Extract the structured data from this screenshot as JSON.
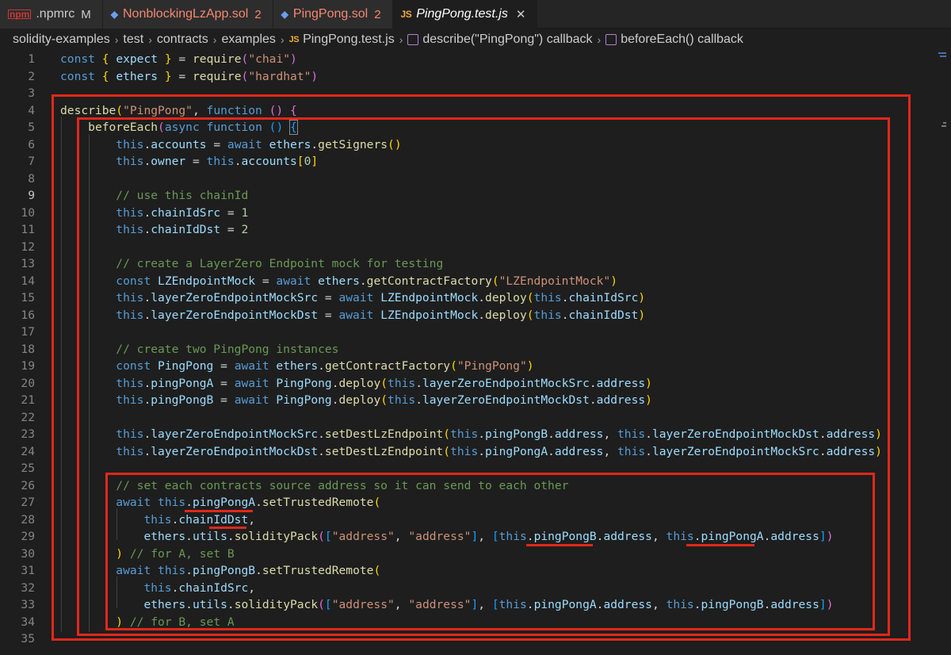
{
  "tabs": [
    {
      "icon": "npm-icon",
      "icon_text": "npm",
      "label": ".npmrc",
      "badge": "M",
      "active": false,
      "error": false
    },
    {
      "icon": "ethereum-icon",
      "icon_text": "◆",
      "label": "NonblockingLzApp.sol",
      "badge": "2",
      "active": false,
      "error": true
    },
    {
      "icon": "ethereum-icon",
      "icon_text": "◆",
      "label": "PingPong.sol",
      "badge": "2",
      "active": false,
      "error": true
    },
    {
      "icon": "js-icon",
      "icon_text": "JS",
      "label": "PingPong.test.js",
      "badge": "",
      "active": true,
      "error": false
    }
  ],
  "close_glyph": "✕",
  "breadcrumb": {
    "items": [
      "solidity-examples",
      "test",
      "contracts",
      "examples"
    ],
    "file_icon_text": "JS",
    "file": "PingPong.test.js",
    "symbols": [
      "describe(\"PingPong\") callback",
      "beforeEach() callback"
    ],
    "separator": "›"
  },
  "current_line": 9,
  "code_lines": [
    [
      [
        "kw",
        "const"
      ],
      [
        "p",
        " "
      ],
      [
        "b1",
        "{"
      ],
      [
        "p",
        " "
      ],
      [
        "var",
        "expect"
      ],
      [
        "p",
        " "
      ],
      [
        "b1",
        "}"
      ],
      [
        "p",
        " = "
      ],
      [
        "fn",
        "require"
      ],
      [
        "b2",
        "("
      ],
      [
        "str",
        "\"chai\""
      ],
      [
        "b2",
        ")"
      ]
    ],
    [
      [
        "kw",
        "const"
      ],
      [
        "p",
        " "
      ],
      [
        "b1",
        "{"
      ],
      [
        "p",
        " "
      ],
      [
        "var",
        "ethers"
      ],
      [
        "p",
        " "
      ],
      [
        "b1",
        "}"
      ],
      [
        "p",
        " = "
      ],
      [
        "fn",
        "require"
      ],
      [
        "b2",
        "("
      ],
      [
        "str",
        "\"hardhat\""
      ],
      [
        "b2",
        ")"
      ]
    ],
    [],
    [
      [
        "fn",
        "describe"
      ],
      [
        "b1",
        "("
      ],
      [
        "str",
        "\"PingPong\""
      ],
      [
        "p",
        ", "
      ],
      [
        "kw",
        "function"
      ],
      [
        "p",
        " "
      ],
      [
        "b2",
        "()"
      ],
      [
        "p",
        " "
      ],
      [
        "b2",
        "{"
      ]
    ],
    [
      [
        "p",
        "    "
      ],
      [
        "fn",
        "beforeEach"
      ],
      [
        "b2",
        "("
      ],
      [
        "kw",
        "async"
      ],
      [
        "p",
        " "
      ],
      [
        "kw",
        "function"
      ],
      [
        "p",
        " "
      ],
      [
        "b3",
        "()"
      ],
      [
        "p",
        " "
      ],
      [
        "b3c",
        "{"
      ]
    ],
    [
      [
        "p",
        "        "
      ],
      [
        "kw",
        "this"
      ],
      [
        "p",
        "."
      ],
      [
        "var",
        "accounts"
      ],
      [
        "p",
        " = "
      ],
      [
        "kw",
        "await"
      ],
      [
        "p",
        " "
      ],
      [
        "var",
        "ethers"
      ],
      [
        "p",
        "."
      ],
      [
        "fn",
        "getSigners"
      ],
      [
        "b1",
        "()"
      ]
    ],
    [
      [
        "p",
        "        "
      ],
      [
        "kw",
        "this"
      ],
      [
        "p",
        "."
      ],
      [
        "var",
        "owner"
      ],
      [
        "p",
        " = "
      ],
      [
        "kw",
        "this"
      ],
      [
        "p",
        "."
      ],
      [
        "var",
        "accounts"
      ],
      [
        "b1",
        "["
      ],
      [
        "num",
        "0"
      ],
      [
        "b1",
        "]"
      ]
    ],
    [],
    [
      [
        "p",
        "        "
      ],
      [
        "cmt",
        "// use this chainId"
      ]
    ],
    [
      [
        "p",
        "        "
      ],
      [
        "kw",
        "this"
      ],
      [
        "p",
        "."
      ],
      [
        "var",
        "chainIdSrc"
      ],
      [
        "p",
        " = "
      ],
      [
        "num",
        "1"
      ]
    ],
    [
      [
        "p",
        "        "
      ],
      [
        "kw",
        "this"
      ],
      [
        "p",
        "."
      ],
      [
        "var",
        "chainIdDst"
      ],
      [
        "p",
        " = "
      ],
      [
        "num",
        "2"
      ]
    ],
    [],
    [
      [
        "p",
        "        "
      ],
      [
        "cmt",
        "// create a LayerZero Endpoint mock for testing"
      ]
    ],
    [
      [
        "p",
        "        "
      ],
      [
        "kw",
        "const"
      ],
      [
        "p",
        " "
      ],
      [
        "var",
        "LZEndpointMock"
      ],
      [
        "p",
        " = "
      ],
      [
        "kw",
        "await"
      ],
      [
        "p",
        " "
      ],
      [
        "var",
        "ethers"
      ],
      [
        "p",
        "."
      ],
      [
        "fn",
        "getContractFactory"
      ],
      [
        "b1",
        "("
      ],
      [
        "str",
        "\"LZEndpointMock\""
      ],
      [
        "b1",
        ")"
      ]
    ],
    [
      [
        "p",
        "        "
      ],
      [
        "kw",
        "this"
      ],
      [
        "p",
        "."
      ],
      [
        "var",
        "layerZeroEndpointMockSrc"
      ],
      [
        "p",
        " = "
      ],
      [
        "kw",
        "await"
      ],
      [
        "p",
        " "
      ],
      [
        "var",
        "LZEndpointMock"
      ],
      [
        "p",
        "."
      ],
      [
        "fn",
        "deploy"
      ],
      [
        "b1",
        "("
      ],
      [
        "kw",
        "this"
      ],
      [
        "p",
        "."
      ],
      [
        "var",
        "chainIdSrc"
      ],
      [
        "b1",
        ")"
      ]
    ],
    [
      [
        "p",
        "        "
      ],
      [
        "kw",
        "this"
      ],
      [
        "p",
        "."
      ],
      [
        "var",
        "layerZeroEndpointMockDst"
      ],
      [
        "p",
        " = "
      ],
      [
        "kw",
        "await"
      ],
      [
        "p",
        " "
      ],
      [
        "var",
        "LZEndpointMock"
      ],
      [
        "p",
        "."
      ],
      [
        "fn",
        "deploy"
      ],
      [
        "b1",
        "("
      ],
      [
        "kw",
        "this"
      ],
      [
        "p",
        "."
      ],
      [
        "var",
        "chainIdDst"
      ],
      [
        "b1",
        ")"
      ]
    ],
    [],
    [
      [
        "p",
        "        "
      ],
      [
        "cmt",
        "// create two PingPong instances"
      ]
    ],
    [
      [
        "p",
        "        "
      ],
      [
        "kw",
        "const"
      ],
      [
        "p",
        " "
      ],
      [
        "var",
        "PingPong"
      ],
      [
        "p",
        " = "
      ],
      [
        "kw",
        "await"
      ],
      [
        "p",
        " "
      ],
      [
        "var",
        "ethers"
      ],
      [
        "p",
        "."
      ],
      [
        "fn",
        "getContractFactory"
      ],
      [
        "b1",
        "("
      ],
      [
        "str",
        "\"PingPong\""
      ],
      [
        "b1",
        ")"
      ]
    ],
    [
      [
        "p",
        "        "
      ],
      [
        "kw",
        "this"
      ],
      [
        "p",
        "."
      ],
      [
        "var",
        "pingPongA"
      ],
      [
        "p",
        " = "
      ],
      [
        "kw",
        "await"
      ],
      [
        "p",
        " "
      ],
      [
        "var",
        "PingPong"
      ],
      [
        "p",
        "."
      ],
      [
        "fn",
        "deploy"
      ],
      [
        "b1",
        "("
      ],
      [
        "kw",
        "this"
      ],
      [
        "p",
        "."
      ],
      [
        "var",
        "layerZeroEndpointMockSrc"
      ],
      [
        "p",
        "."
      ],
      [
        "var",
        "address"
      ],
      [
        "b1",
        ")"
      ]
    ],
    [
      [
        "p",
        "        "
      ],
      [
        "kw",
        "this"
      ],
      [
        "p",
        "."
      ],
      [
        "var",
        "pingPongB"
      ],
      [
        "p",
        " = "
      ],
      [
        "kw",
        "await"
      ],
      [
        "p",
        " "
      ],
      [
        "var",
        "PingPong"
      ],
      [
        "p",
        "."
      ],
      [
        "fn",
        "deploy"
      ],
      [
        "b1",
        "("
      ],
      [
        "kw",
        "this"
      ],
      [
        "p",
        "."
      ],
      [
        "var",
        "layerZeroEndpointMockDst"
      ],
      [
        "p",
        "."
      ],
      [
        "var",
        "address"
      ],
      [
        "b1",
        ")"
      ]
    ],
    [],
    [
      [
        "p",
        "        "
      ],
      [
        "kw",
        "this"
      ],
      [
        "p",
        "."
      ],
      [
        "var",
        "layerZeroEndpointMockSrc"
      ],
      [
        "p",
        "."
      ],
      [
        "fn",
        "setDestLzEndpoint"
      ],
      [
        "b1",
        "("
      ],
      [
        "kw",
        "this"
      ],
      [
        "p",
        "."
      ],
      [
        "var",
        "pingPongB"
      ],
      [
        "p",
        "."
      ],
      [
        "var",
        "address"
      ],
      [
        "p",
        ", "
      ],
      [
        "kw",
        "this"
      ],
      [
        "p",
        "."
      ],
      [
        "var",
        "layerZeroEndpointMockDst"
      ],
      [
        "p",
        "."
      ],
      [
        "var",
        "address"
      ],
      [
        "b1",
        ")"
      ]
    ],
    [
      [
        "p",
        "        "
      ],
      [
        "kw",
        "this"
      ],
      [
        "p",
        "."
      ],
      [
        "var",
        "layerZeroEndpointMockDst"
      ],
      [
        "p",
        "."
      ],
      [
        "fn",
        "setDestLzEndpoint"
      ],
      [
        "b1",
        "("
      ],
      [
        "kw",
        "this"
      ],
      [
        "p",
        "."
      ],
      [
        "var",
        "pingPongA"
      ],
      [
        "p",
        "."
      ],
      [
        "var",
        "address"
      ],
      [
        "p",
        ", "
      ],
      [
        "kw",
        "this"
      ],
      [
        "p",
        "."
      ],
      [
        "var",
        "layerZeroEndpointMockSrc"
      ],
      [
        "p",
        "."
      ],
      [
        "var",
        "address"
      ],
      [
        "b1",
        ")"
      ]
    ],
    [],
    [
      [
        "p",
        "        "
      ],
      [
        "cmt",
        "// set each contracts source address so it can send to each other"
      ]
    ],
    [
      [
        "p",
        "        "
      ],
      [
        "kw",
        "await"
      ],
      [
        "p",
        " "
      ],
      [
        "kw",
        "this"
      ],
      [
        "p",
        "."
      ],
      [
        "var",
        "pingPongA"
      ],
      [
        "p",
        "."
      ],
      [
        "fn",
        "setTrustedRemote"
      ],
      [
        "b1",
        "("
      ]
    ],
    [
      [
        "p",
        "            "
      ],
      [
        "kw",
        "this"
      ],
      [
        "p",
        "."
      ],
      [
        "var",
        "chainIdDst"
      ],
      [
        "p",
        ","
      ]
    ],
    [
      [
        "p",
        "            "
      ],
      [
        "var",
        "ethers"
      ],
      [
        "p",
        "."
      ],
      [
        "var",
        "utils"
      ],
      [
        "p",
        "."
      ],
      [
        "fn",
        "solidityPack"
      ],
      [
        "b2",
        "("
      ],
      [
        "b3",
        "["
      ],
      [
        "str",
        "\"address\""
      ],
      [
        "p",
        ", "
      ],
      [
        "str",
        "\"address\""
      ],
      [
        "b3",
        "]"
      ],
      [
        "p",
        ", "
      ],
      [
        "b3",
        "["
      ],
      [
        "kw",
        "this"
      ],
      [
        "p",
        "."
      ],
      [
        "var",
        "pingPongB"
      ],
      [
        "p",
        "."
      ],
      [
        "var",
        "address"
      ],
      [
        "p",
        ", "
      ],
      [
        "kw",
        "this"
      ],
      [
        "p",
        "."
      ],
      [
        "var",
        "pingPongA"
      ],
      [
        "p",
        "."
      ],
      [
        "var",
        "address"
      ],
      [
        "b3",
        "]"
      ],
      [
        "b2",
        ")"
      ]
    ],
    [
      [
        "p",
        "        "
      ],
      [
        "b1",
        ")"
      ],
      [
        "p",
        " "
      ],
      [
        "cmt",
        "// for A, set B"
      ]
    ],
    [
      [
        "p",
        "        "
      ],
      [
        "kw",
        "await"
      ],
      [
        "p",
        " "
      ],
      [
        "kw",
        "this"
      ],
      [
        "p",
        "."
      ],
      [
        "var",
        "pingPongB"
      ],
      [
        "p",
        "."
      ],
      [
        "fn",
        "setTrustedRemote"
      ],
      [
        "b1",
        "("
      ]
    ],
    [
      [
        "p",
        "            "
      ],
      [
        "kw",
        "this"
      ],
      [
        "p",
        "."
      ],
      [
        "var",
        "chainIdSrc"
      ],
      [
        "p",
        ","
      ]
    ],
    [
      [
        "p",
        "            "
      ],
      [
        "var",
        "ethers"
      ],
      [
        "p",
        "."
      ],
      [
        "var",
        "utils"
      ],
      [
        "p",
        "."
      ],
      [
        "fn",
        "solidityPack"
      ],
      [
        "b2",
        "("
      ],
      [
        "b3",
        "["
      ],
      [
        "str",
        "\"address\""
      ],
      [
        "p",
        ", "
      ],
      [
        "str",
        "\"address\""
      ],
      [
        "b3",
        "]"
      ],
      [
        "p",
        ", "
      ],
      [
        "b3",
        "["
      ],
      [
        "kw",
        "this"
      ],
      [
        "p",
        "."
      ],
      [
        "var",
        "pingPongA"
      ],
      [
        "p",
        "."
      ],
      [
        "var",
        "address"
      ],
      [
        "p",
        ", "
      ],
      [
        "kw",
        "this"
      ],
      [
        "p",
        "."
      ],
      [
        "var",
        "pingPongB"
      ],
      [
        "p",
        "."
      ],
      [
        "var",
        "address"
      ],
      [
        "b3",
        "]"
      ],
      [
        "b2",
        ")"
      ]
    ],
    [
      [
        "p",
        "        "
      ],
      [
        "b1",
        ")"
      ],
      [
        "p",
        " "
      ],
      [
        "cmt",
        "// for B, set A"
      ]
    ],
    []
  ]
}
